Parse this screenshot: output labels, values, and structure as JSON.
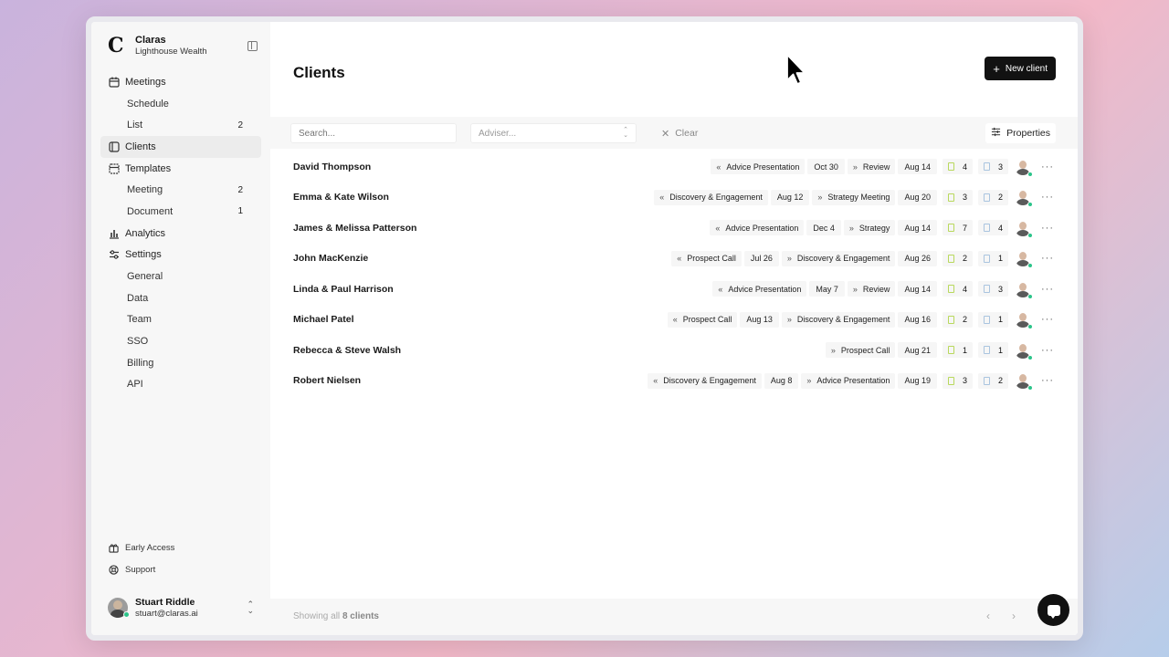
{
  "brand": {
    "logo": "C",
    "name": "Claras",
    "subtitle": "Lighthouse Wealth"
  },
  "sidebar": {
    "items": [
      {
        "label": "Meetings",
        "icon": "calendar-icon"
      },
      {
        "label": "Schedule",
        "sub": true
      },
      {
        "label": "List",
        "sub": true,
        "count": "2"
      },
      {
        "label": "Clients",
        "icon": "users-icon",
        "active": true
      },
      {
        "label": "Templates",
        "icon": "template-icon"
      },
      {
        "label": "Meeting",
        "sub": true,
        "count": "2"
      },
      {
        "label": "Document",
        "sub": true,
        "count": "1"
      },
      {
        "label": "Analytics",
        "icon": "bar-chart-icon"
      },
      {
        "label": "Settings",
        "icon": "settings-icon"
      },
      {
        "label": "General",
        "sub": true
      },
      {
        "label": "Data",
        "sub": true
      },
      {
        "label": "Team",
        "sub": true
      },
      {
        "label": "SSO",
        "sub": true
      },
      {
        "label": "Billing",
        "sub": true
      },
      {
        "label": "API",
        "sub": true
      }
    ],
    "bottom_links": [
      {
        "label": "Early Access",
        "icon": "gift-icon"
      },
      {
        "label": "Support",
        "icon": "lifebuoy-icon"
      }
    ]
  },
  "user": {
    "name": "Stuart Riddle",
    "email": "stuart@claras.ai"
  },
  "header": {
    "title": "Clients",
    "new_button": "New client"
  },
  "toolbar": {
    "search_placeholder": "Search...",
    "adviser_placeholder": "Adviser...",
    "clear_label": "Clear",
    "properties_label": "Properties"
  },
  "clients": [
    {
      "name": "David Thompson",
      "meetings": [
        {
          "dir": "«",
          "type": "Advice Presentation",
          "date": "Oct 30"
        },
        {
          "dir": "»",
          "type": "Review",
          "date": "Aug 14"
        }
      ],
      "green_count": "4",
      "blue_count": "3"
    },
    {
      "name": "Emma & Kate Wilson",
      "meetings": [
        {
          "dir": "«",
          "type": "Discovery & Engagement",
          "date": "Aug 12"
        },
        {
          "dir": "»",
          "type": "Strategy Meeting",
          "date": "Aug 20"
        }
      ],
      "green_count": "3",
      "blue_count": "2"
    },
    {
      "name": "James & Melissa Patterson",
      "meetings": [
        {
          "dir": "«",
          "type": "Advice Presentation",
          "date": "Dec 4"
        },
        {
          "dir": "»",
          "type": "Strategy",
          "date": "Aug 14"
        }
      ],
      "green_count": "7",
      "blue_count": "4"
    },
    {
      "name": "John MacKenzie",
      "meetings": [
        {
          "dir": "«",
          "type": "Prospect Call",
          "date": "Jul 26"
        },
        {
          "dir": "»",
          "type": "Discovery & Engagement",
          "date": "Aug 26"
        }
      ],
      "green_count": "2",
      "blue_count": "1"
    },
    {
      "name": "Linda & Paul Harrison",
      "meetings": [
        {
          "dir": "«",
          "type": "Advice Presentation",
          "date": "May 7"
        },
        {
          "dir": "»",
          "type": "Review",
          "date": "Aug 14"
        }
      ],
      "green_count": "4",
      "blue_count": "3"
    },
    {
      "name": "Michael Patel",
      "meetings": [
        {
          "dir": "«",
          "type": "Prospect Call",
          "date": "Aug 13"
        },
        {
          "dir": "»",
          "type": "Discovery & Engagement",
          "date": "Aug 16"
        }
      ],
      "green_count": "2",
      "blue_count": "1"
    },
    {
      "name": "Rebecca & Steve Walsh",
      "meetings": [
        {
          "dir": "»",
          "type": "Prospect Call",
          "date": "Aug 21"
        }
      ],
      "green_count": "1",
      "blue_count": "1"
    },
    {
      "name": "Robert Nielsen",
      "meetings": [
        {
          "dir": "«",
          "type": "Discovery & Engagement",
          "date": "Aug 8"
        },
        {
          "dir": "»",
          "type": "Advice Presentation",
          "date": "Aug 19"
        }
      ],
      "green_count": "3",
      "blue_count": "2"
    }
  ],
  "footer": {
    "showing_prefix": "Showing all",
    "showing_count": "8 clients"
  },
  "colors": {
    "accent": "#121212",
    "online": "#2bc48a",
    "doc_green": "#b8d85c",
    "doc_blue": "#a9c4df"
  }
}
